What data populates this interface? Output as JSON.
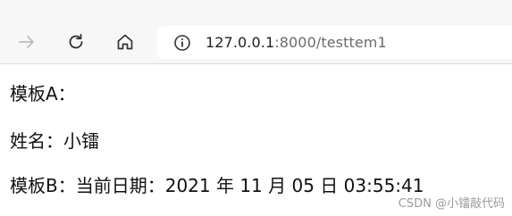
{
  "browser": {
    "url_host": "127.0.0.1",
    "url_rest": ":8000/testtem1"
  },
  "page": {
    "line_a": "模板A：",
    "line_name": "姓名：小镭",
    "line_b": "模板B：当前日期：2021 年 11 月 05 日 03:55:41"
  },
  "watermark": "CSDN @小镭敲代码"
}
